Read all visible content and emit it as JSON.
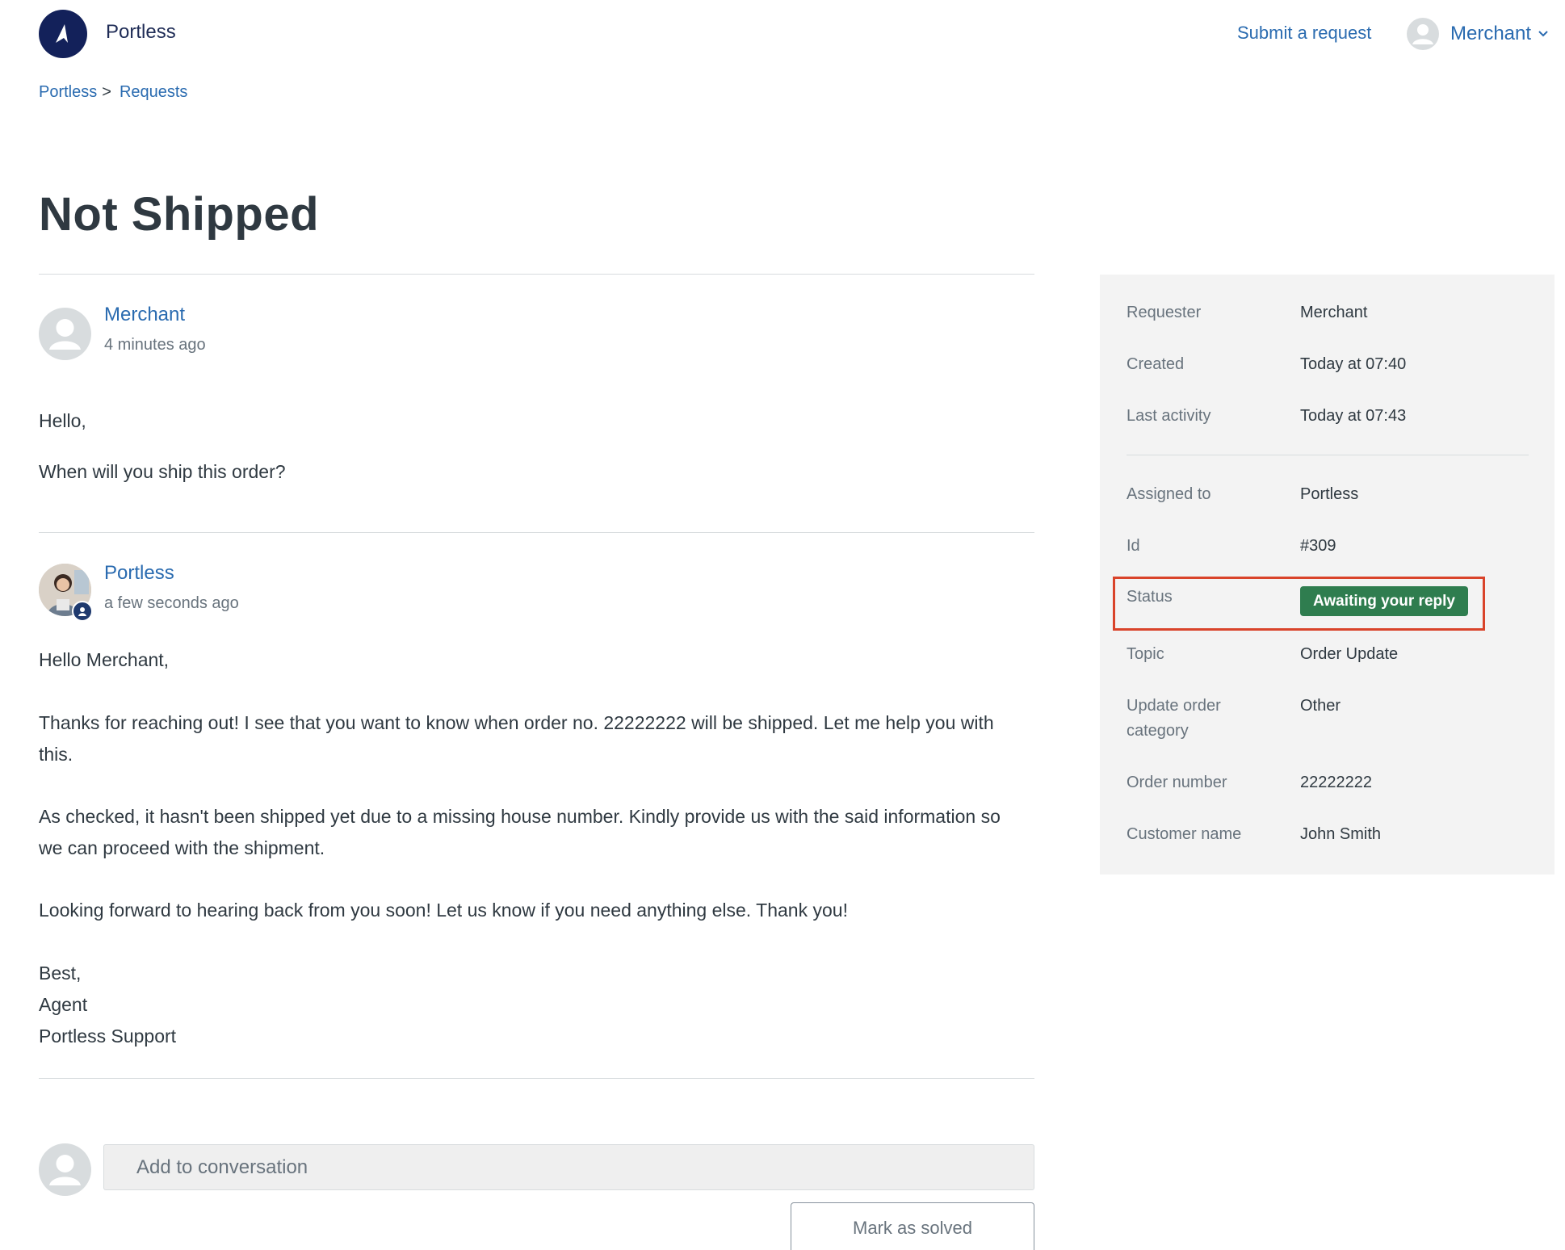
{
  "header": {
    "brand": "Portless",
    "submit_request": "Submit a request",
    "user_name": "Merchant"
  },
  "breadcrumb": {
    "home": "Portless",
    "separator": ">",
    "current": "Requests"
  },
  "page": {
    "title": "Not Shipped"
  },
  "comments": [
    {
      "author": "Merchant",
      "time": "4 minutes ago",
      "paragraphs": [
        "Hello,",
        "When will you ship this order?"
      ]
    },
    {
      "author": "Portless",
      "time": "a few seconds ago",
      "paragraphs": [
        "Hello Merchant,",
        "Thanks for reaching out! I see that you want to know when order no. 22222222 will be shipped. Let me help you with this.",
        "As checked, it hasn't been shipped yet due to a missing house number. Kindly provide us with the said information so we can proceed with the shipment.",
        "Looking forward to hearing back from you soon! Let us know if you need anything else. Thank you!",
        "Best,",
        "Agent",
        "Portless Support"
      ]
    }
  ],
  "reply": {
    "placeholder": "Add to conversation",
    "mark_solved": "Mark as solved"
  },
  "details": {
    "requester_label": "Requester",
    "requester": "Merchant",
    "created_label": "Created",
    "created": "Today at 07:40",
    "last_activity_label": "Last activity",
    "last_activity": "Today at 07:43",
    "assigned_label": "Assigned to",
    "assigned": "Portless",
    "id_label": "Id",
    "id": "#309",
    "status_label": "Status",
    "status": "Awaiting your reply",
    "topic_label": "Topic",
    "topic": "Order Update",
    "category_label_1": "Update order",
    "category_label_2": "category",
    "category": "Other",
    "order_label": "Order number",
    "order": "22222222",
    "customer_label": "Customer name",
    "customer": "John Smith"
  },
  "colors": {
    "link": "#2a6bb0",
    "status_badge": "#2f7d4f",
    "highlight": "#d9432a",
    "brand": "#13215a"
  },
  "icons": {
    "logo": "paper-plane-logo-icon",
    "avatar": "user-placeholder-icon",
    "chevron": "chevron-down-icon",
    "agent_badge": "agent-user-icon"
  }
}
